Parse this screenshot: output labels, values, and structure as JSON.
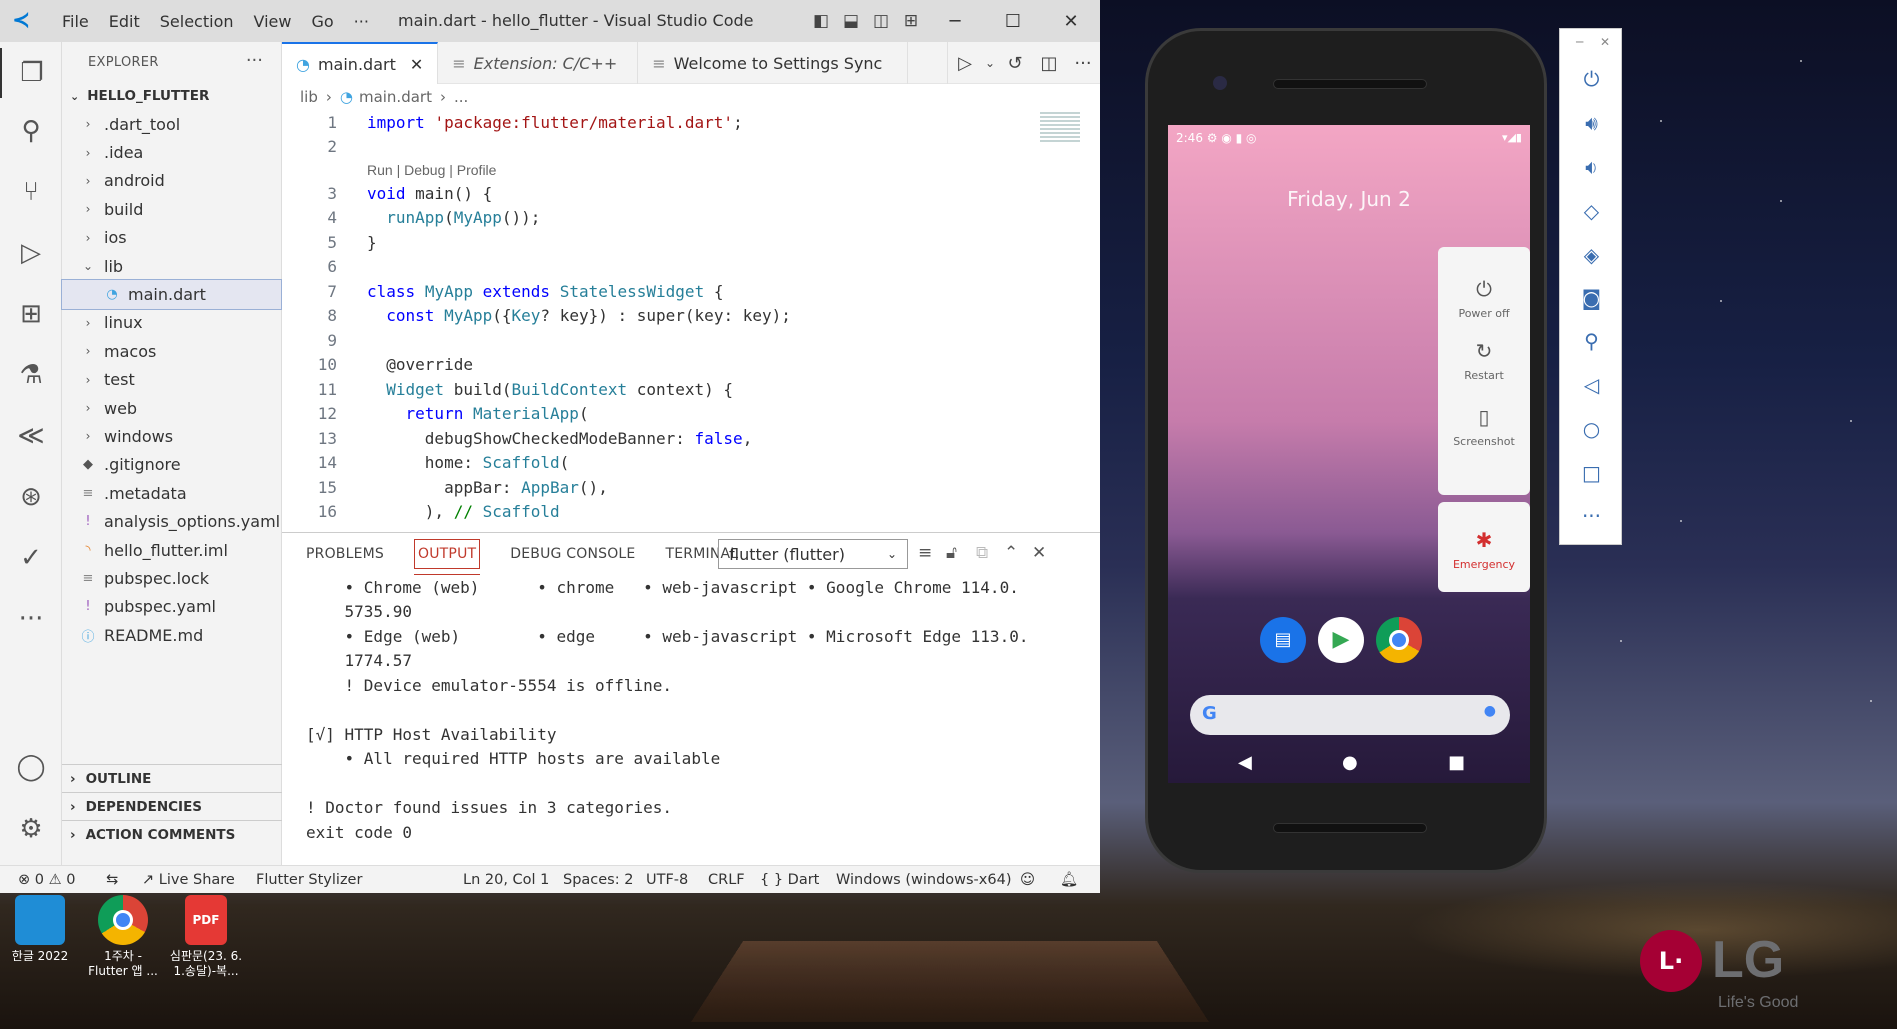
{
  "titlebar": {
    "menus": [
      "File",
      "Edit",
      "Selection",
      "View",
      "Go",
      "···"
    ],
    "title": "main.dart - hello_flutter - Visual Studio Code"
  },
  "explorer": {
    "header": "EXPLORER",
    "root": "HELLO_FLUTTER",
    "items": [
      {
        "label": ".dart_tool",
        "type": "folder"
      },
      {
        "label": ".idea",
        "type": "folder"
      },
      {
        "label": "android",
        "type": "folder"
      },
      {
        "label": "build",
        "type": "folder"
      },
      {
        "label": "ios",
        "type": "folder"
      },
      {
        "label": "lib",
        "type": "folder-open"
      },
      {
        "label": "main.dart",
        "type": "dart",
        "selected": true
      },
      {
        "label": "linux",
        "type": "folder"
      },
      {
        "label": "macos",
        "type": "folder"
      },
      {
        "label": "test",
        "type": "folder"
      },
      {
        "label": "web",
        "type": "folder"
      },
      {
        "label": "windows",
        "type": "folder"
      },
      {
        "label": ".gitignore",
        "type": "git"
      },
      {
        "label": ".metadata",
        "type": "text"
      },
      {
        "label": "analysis_options.yaml",
        "type": "yaml"
      },
      {
        "label": "hello_flutter.iml",
        "type": "rss"
      },
      {
        "label": "pubspec.lock",
        "type": "text"
      },
      {
        "label": "pubspec.yaml",
        "type": "yaml"
      },
      {
        "label": "README.md",
        "type": "info"
      }
    ],
    "outline": "OUTLINE",
    "dependencies": "DEPENDENCIES",
    "action_comments": "ACTION COMMENTS"
  },
  "tabs": [
    {
      "label": "main.dart",
      "active": true
    },
    {
      "label": "Extension: C/C++",
      "active": false
    },
    {
      "label": "Welcome to Settings Sync",
      "active": false
    }
  ],
  "breadcrumb": {
    "folder": "lib",
    "file": "main.dart",
    "rest": "..."
  },
  "code": {
    "lens": "Run | Debug | Profile",
    "lines": [
      {
        "n": "1",
        "t": "import 'package:flutter/material.dart';"
      },
      {
        "n": "2",
        "t": ""
      },
      {
        "n": "3",
        "t": "void main() {"
      },
      {
        "n": "4",
        "t": "  runApp(MyApp());"
      },
      {
        "n": "5",
        "t": "}"
      },
      {
        "n": "6",
        "t": ""
      },
      {
        "n": "7",
        "t": "class MyApp extends StatelessWidget {"
      },
      {
        "n": "8",
        "t": "  const MyApp({Key? key}) : super(key: key);"
      },
      {
        "n": "9",
        "t": ""
      },
      {
        "n": "10",
        "t": "  @override"
      },
      {
        "n": "11",
        "t": "  Widget build(BuildContext context) {"
      },
      {
        "n": "12",
        "t": "    return MaterialApp("
      },
      {
        "n": "13",
        "t": "      debugShowCheckedModeBanner: false,"
      },
      {
        "n": "14",
        "t": "      home: Scaffold("
      },
      {
        "n": "15",
        "t": "        appBar: AppBar(),"
      },
      {
        "n": "16",
        "t": "      ), // Scaffold"
      }
    ]
  },
  "panel": {
    "tabs": [
      "PROBLEMS",
      "OUTPUT",
      "DEBUG CONSOLE",
      "TERMINAL"
    ],
    "active_tab": "OUTPUT",
    "channel": "flutter (flutter)",
    "lines": [
      "    • Chrome (web)      • chrome   • web-javascript • Google Chrome 114.0.",
      "    5735.90",
      "    • Edge (web)        • edge     • web-javascript • Microsoft Edge 113.0.",
      "    1774.57",
      "    ! Device emulator-5554 is offline.",
      "",
      "[√] HTTP Host Availability",
      "    • All required HTTP hosts are available",
      "",
      "! Doctor found issues in 3 categories.",
      "exit code 0"
    ]
  },
  "statusbar": {
    "errors": "0",
    "warnings": "0",
    "live_share": "Live Share",
    "stylizer": "Flutter Stylizer",
    "position": "Ln 20, Col 1",
    "spaces": "Spaces: 2",
    "encoding": "UTF-8",
    "eol": "CRLF",
    "language": "Dart",
    "device": "Windows (windows-x64)"
  },
  "desktop_icons": [
    {
      "label": "한글 2022",
      "color": "#1f8dd6"
    },
    {
      "label": "1주차 - Flutter 앱 ...",
      "color": "#ffffff"
    },
    {
      "label": "심판문(23. 6. 1.송달)-복...",
      "color": "#e53935"
    }
  ],
  "phone": {
    "time": "2:46",
    "date": "Friday, Jun 2",
    "power_menu": [
      "Power off",
      "Restart",
      "Screenshot"
    ],
    "emergency": "Emergency"
  },
  "emulator_toolbar": {
    "icons": [
      "power-icon",
      "volume-up-icon",
      "volume-down-icon",
      "rotate-left-icon",
      "rotate-right-icon",
      "camera-icon",
      "zoom-icon",
      "back-icon",
      "home-icon",
      "overview-icon",
      "more-icon"
    ]
  },
  "brand": {
    "logo": "LG",
    "tagline": "Life's Good"
  },
  "colors": {
    "accent": "#1a73e8",
    "output_tab": "#c0392b",
    "vscode_blue": "#0078d4",
    "lg_red": "#a50034"
  }
}
